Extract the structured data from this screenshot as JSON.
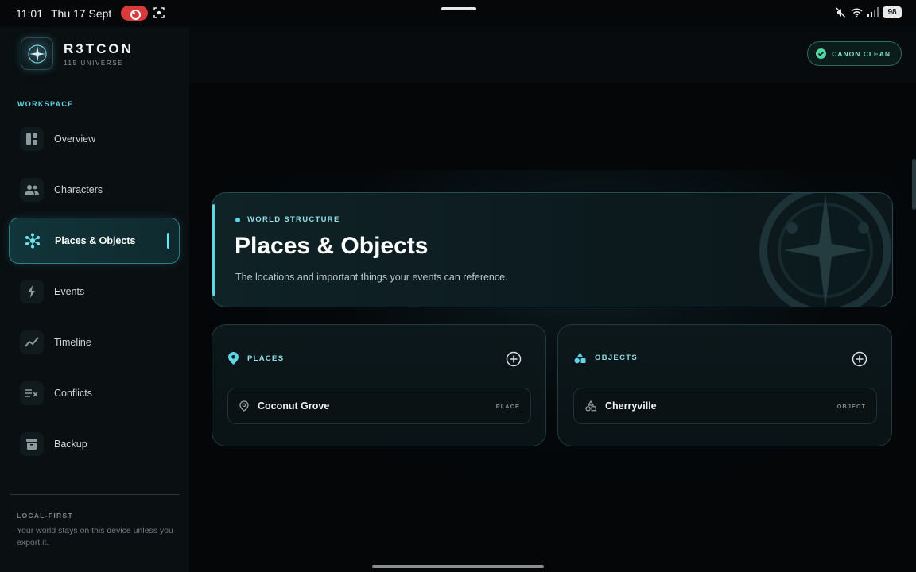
{
  "status_bar": {
    "time": "11:01",
    "date": "Thu 17 Sept",
    "battery": "98"
  },
  "brand": {
    "name": "R3TCON",
    "subtitle": "115 UNIVERSE"
  },
  "sidebar": {
    "section_label": "WORKSPACE",
    "items": [
      {
        "label": "Overview",
        "icon": "dashboard-icon"
      },
      {
        "label": "Characters",
        "icon": "people-icon"
      },
      {
        "label": "Places & Objects",
        "icon": "hub-icon",
        "active": true
      },
      {
        "label": "Events",
        "icon": "bolt-icon"
      },
      {
        "label": "Timeline",
        "icon": "trend-line-icon"
      },
      {
        "label": "Conflicts",
        "icon": "conflict-icon"
      },
      {
        "label": "Backup",
        "icon": "archive-icon"
      }
    ],
    "local_first_label": "LOCAL-FIRST",
    "local_first_text": "Your world stays on this device unless you export it."
  },
  "header": {
    "badge_label": "CANON CLEAN"
  },
  "hero": {
    "eyebrow": "WORLD STRUCTURE",
    "title": "Places & Objects",
    "description": "The locations and important things your events can reference."
  },
  "places": {
    "title": "PLACES",
    "items": [
      {
        "name": "Coconut Grove",
        "tag": "PLACE"
      }
    ]
  },
  "objects": {
    "title": "OBJECTS",
    "items": [
      {
        "name": "Cherryville",
        "tag": "OBJECT"
      }
    ]
  },
  "colors": {
    "accent": "#5fd6e6",
    "badge_green": "#4fd6a4",
    "background": "#050708",
    "recording_red": "#d93a3a"
  }
}
